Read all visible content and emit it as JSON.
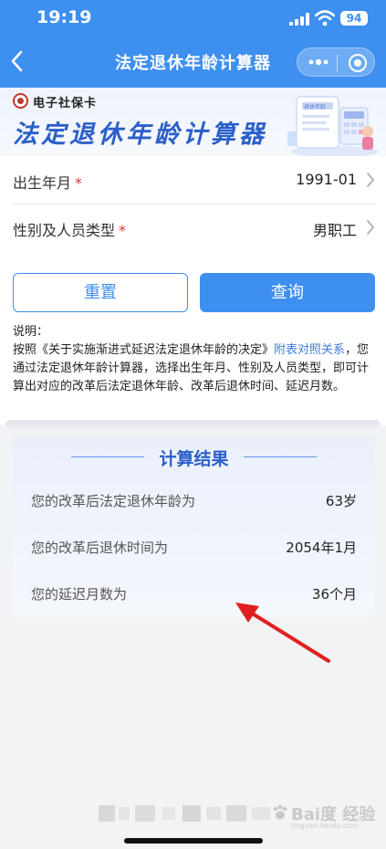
{
  "status_bar": {
    "time": "19:19",
    "battery": "94"
  },
  "nav": {
    "title": "法定退休年龄计算器",
    "back_icon": "chevron-left-icon",
    "more_icon": "more-dots-icon",
    "close_icon": "target-circle-icon"
  },
  "banner": {
    "brand": "电子社保卡",
    "title": "法定退休年龄计算器",
    "illustration_label": "退休年龄"
  },
  "form": {
    "birth": {
      "label": "出生年月",
      "required": "*",
      "value": "1991-01"
    },
    "type": {
      "label": "性别及人员类型",
      "required": "*",
      "value": "男职工"
    }
  },
  "buttons": {
    "reset": "重置",
    "query": "查询"
  },
  "note": {
    "heading": "说明：",
    "text_before": "按照《关于实施渐进式延迟法定退休年龄的决定》",
    "link": "附表对照关系",
    "text_after": "，您通过法定退休年龄计算器，选择出生年月、性别及人员类型，即可计算出对应的改革后法定退休年龄、改革后退休时间、延迟月数。"
  },
  "results": {
    "title": "计算结果",
    "rows": [
      {
        "label": "您的改革后法定退休年龄为",
        "value": "63岁"
      },
      {
        "label": "您的改革后退休时间为",
        "value": "2054年1月"
      },
      {
        "label": "您的延迟月数为",
        "value": "36个月"
      }
    ]
  },
  "watermark": {
    "text": "Bai度 经验",
    "sub": "jingyan.baidu.com"
  },
  "colors": {
    "primary": "#3d8ff0",
    "title_blue": "#2b5fc9",
    "required": "#e03131",
    "arrow": "#e02020"
  }
}
